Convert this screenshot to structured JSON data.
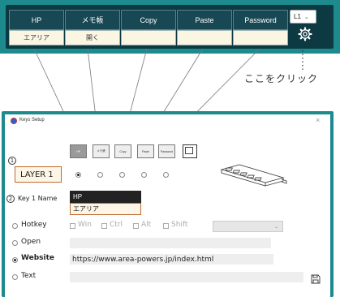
{
  "toolbar": {
    "keys": [
      {
        "header": "HP",
        "value": "エアリア"
      },
      {
        "header": "メモ帳",
        "value": "開く"
      },
      {
        "header": "Copy",
        "value": ""
      },
      {
        "header": "Paste",
        "value": ""
      },
      {
        "header": "Password",
        "value": ""
      }
    ],
    "layer_select": "L1",
    "layer_select_arrow": "⌄",
    "gear_icon": "gear-icon"
  },
  "annotation": {
    "click_here": "ここをクリック"
  },
  "dialog": {
    "title": "Keys Setup",
    "close": "×",
    "mini_buttons": [
      "HP",
      "メモ帳",
      "Copy",
      "Paste",
      "Password"
    ],
    "step1": "1",
    "step2": "2",
    "layer_value": "LAYER 1",
    "key_name_label": "Key 1 Name",
    "key_header": "HP",
    "key_name_value": "エアリア",
    "options": {
      "hotkey": "Hotkey",
      "open": "Open",
      "website": "Website",
      "text": "Text"
    },
    "modifiers": [
      "Win",
      "Ctrl",
      "Alt",
      "Shift"
    ],
    "hotkey_dropdown_arrow": "⌄",
    "website_url": "https://www.area-powers.jp/index.html",
    "selected_option": "website",
    "accent_color": "#1d8a8e",
    "input_border_color": "#c0692f"
  }
}
